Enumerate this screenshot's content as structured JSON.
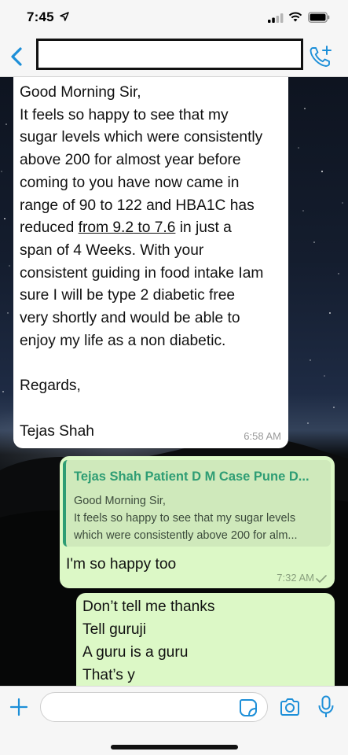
{
  "status_bar": {
    "time": "7:45",
    "icons": [
      "location-arrow-icon",
      "signal-icon",
      "wifi-icon",
      "battery-icon"
    ]
  },
  "header": {
    "back_icon": "chevron-left-icon",
    "contact_name": "",
    "call_icon": "add-call-icon",
    "accent_color": "#1d8fd8"
  },
  "messages": [
    {
      "direction": "incoming",
      "text": "Good Morning Sir,\nIt feels so happy to see that my\nsugar levels which were consistently\nabove 200 for almost year before\ncoming to you have now came in\nrange of 90 to 122 and HBA1C has\nreduced ",
      "underlined": "from 9.2 to 7.6",
      "text_after": " in just a\nspan of 4 Weeks. With your\nconsistent guiding in food intake Iam\nsure I will be type 2 diabetic free\nvery shortly and would be able to\nenjoy my life as a non diabetic.\n\nRegards,\n\nTejas Shah",
      "time": "6:58 AM"
    },
    {
      "direction": "outgoing",
      "quote": {
        "author": "Tejas Shah Patient D M Case Pune D...",
        "line1": "Good Morning Sir,",
        "line2": "It feels so happy to see that my sugar levels",
        "line3": "which were consistently above 200 for alm..."
      },
      "text": "I'm so happy too",
      "time": "7:32 AM"
    },
    {
      "direction": "outgoing",
      "text": "Don’t tell me thanks\nTell guruji\nA guru is a guru\nThat’s y"
    }
  ],
  "input_bar": {
    "placeholder": "",
    "icons": [
      "plus-icon",
      "sticker-icon",
      "camera-icon",
      "microphone-icon"
    ]
  },
  "colors": {
    "outgoing_bubble": "#dcf8c6",
    "incoming_bubble": "#ffffff",
    "quote_accent": "#2e9d74"
  }
}
